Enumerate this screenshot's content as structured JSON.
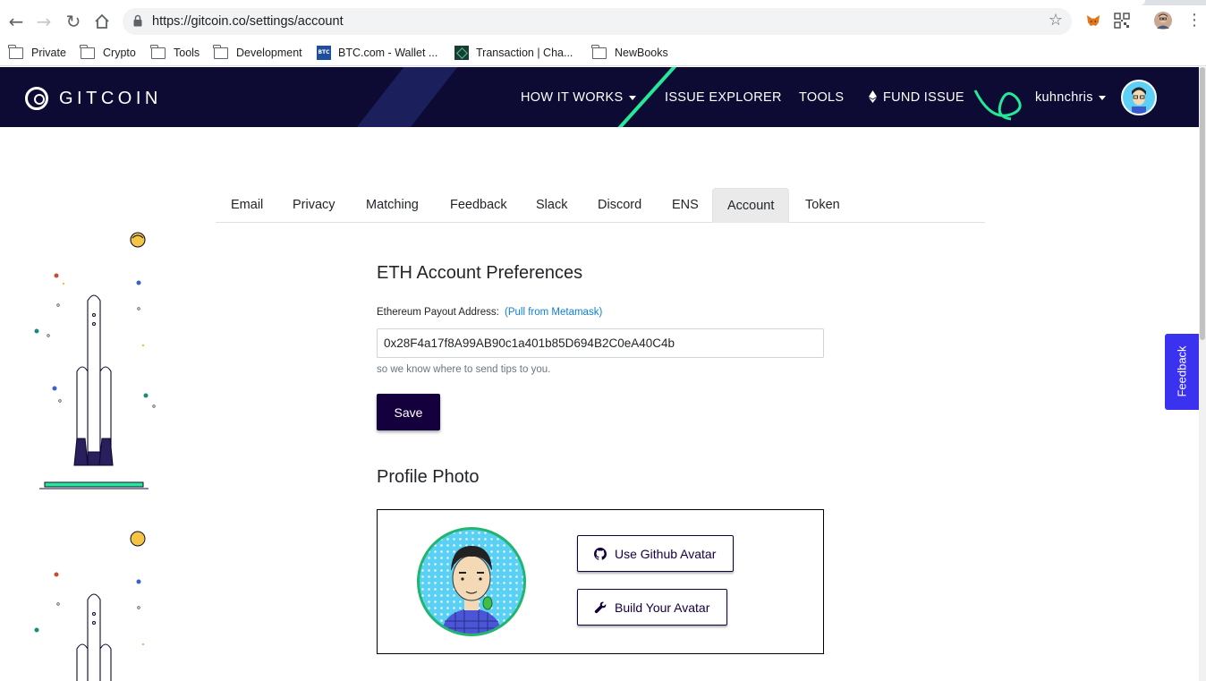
{
  "browser": {
    "url": "https://gitcoin.co/settings/account",
    "bookmarks": [
      {
        "label": "Private",
        "icon": "folder-icon"
      },
      {
        "label": "Crypto",
        "icon": "folder-icon"
      },
      {
        "label": "Tools",
        "icon": "folder-icon"
      },
      {
        "label": "Development",
        "icon": "folder-icon"
      },
      {
        "label": "BTC.com - Wallet ...",
        "icon": "btc-favicon"
      },
      {
        "label": "Transaction | Cha...",
        "icon": "transaction-favicon"
      },
      {
        "label": "NewBooks",
        "icon": "folder-icon"
      }
    ],
    "btc_favicon_text": "BTC"
  },
  "site": {
    "logo_text": "GITCOIN",
    "nav": {
      "how_it_works": "HOW IT WORKS",
      "issue_explorer": "ISSUE EXPLORER",
      "tools": "TOOLS",
      "fund_issue": "FUND ISSUE",
      "username": "kuhnchris"
    },
    "colors": {
      "nav_bg": "#0d0b33",
      "accent_green": "#25e899",
      "primary": "#15003e",
      "feedback": "#3b32f0"
    }
  },
  "settings": {
    "tabs": [
      "Email",
      "Privacy",
      "Matching",
      "Feedback",
      "Slack",
      "Discord",
      "ENS",
      "Account",
      "Token"
    ],
    "active_tab": "Account",
    "eth": {
      "heading": "ETH Account Preferences",
      "label": "Ethereum Payout Address:",
      "pull_link": "(Pull from Metamask)",
      "address": "0x28F4a17f8A99AB90c1a401b85D694B2C0eA40C4b",
      "help": "so we know where to send tips to you.",
      "save": "Save"
    },
    "photo": {
      "heading": "Profile Photo",
      "github_btn": "Use Github Avatar",
      "build_btn": "Build Your Avatar"
    }
  },
  "feedback_tab": "Feedback"
}
